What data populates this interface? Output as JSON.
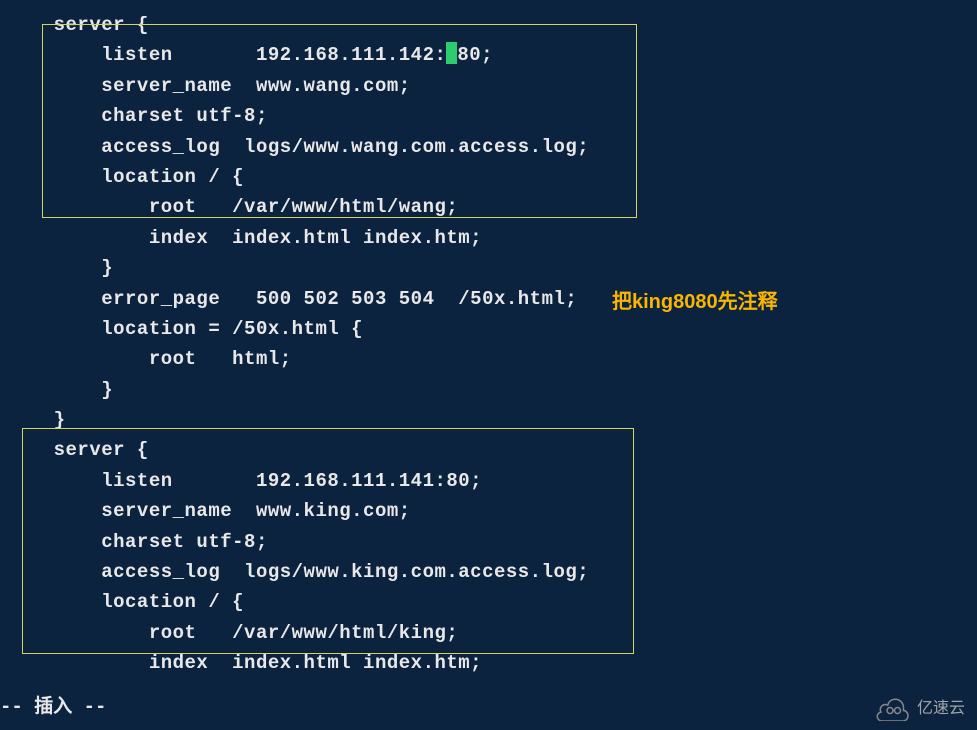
{
  "editor": {
    "lines": [
      "    server {",
      "        listen       192.168.111.142:",
      "80;",
      "        server_name  www.wang.com;",
      "        charset utf-8;",
      "        access_log  logs/www.wang.com.access.log;",
      "        location / {",
      "            root   /var/www/html/wang;",
      "            index  index.html index.htm;",
      "        }",
      "        error_page   500 502 503 504  /50x.html;",
      "        location = /50x.html {",
      "            root   html;",
      "        }",
      "    }",
      "    server {",
      "        listen       192.168.111.141:80;",
      "        server_name  www.king.com;",
      "        charset utf-8;",
      "        access_log  logs/www.king.com.access.log;",
      "        location / {",
      "            root   /var/www/html/king;",
      "            index  index.html index.htm;"
    ]
  },
  "annotation": {
    "comment1": "把king8080先注释"
  },
  "status": {
    "mode": "-- 插入 --"
  },
  "watermark": {
    "text": "亿速云"
  }
}
